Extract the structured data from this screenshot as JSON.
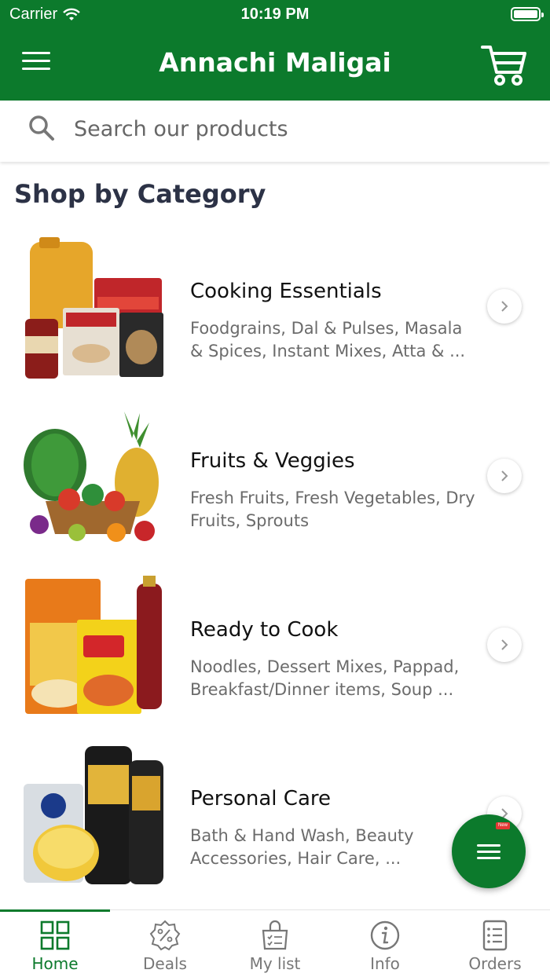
{
  "status_bar": {
    "carrier": "Carrier",
    "time": "10:19 PM"
  },
  "header": {
    "title": "Annachi Maligai",
    "menu_icon": "hamburger-menu-icon",
    "cart_icon": "shopping-cart-icon"
  },
  "search": {
    "placeholder": "Search our products",
    "icon": "search-icon"
  },
  "section_title": "Shop by Category",
  "categories": [
    {
      "name": "Cooking Essentials",
      "desc_line1": "Foodgrains, Dal & Pulses, Masala",
      "desc_line2": "& Spices, Instant Mixes, Atta & ..."
    },
    {
      "name": "Fruits & Veggies",
      "desc_line1": "Fresh Fruits, Fresh Vegetables, Dry",
      "desc_line2": "Fruits, Sprouts"
    },
    {
      "name": "Ready to Cook",
      "desc_line1": "Noodles, Dessert Mixes, Pappad,",
      "desc_line2": "Breakfast/Dinner items, Soup ..."
    },
    {
      "name": "Personal Care",
      "desc_line1": "Bath & Hand Wash, Beauty",
      "desc_line2": "Accessories, Hair Care, ..."
    }
  ],
  "fab": {
    "badge": "New"
  },
  "tabs": [
    {
      "label": "Home",
      "icon": "grid-home-icon",
      "active": true
    },
    {
      "label": "Deals",
      "icon": "deals-badge-icon",
      "active": false
    },
    {
      "label": "My list",
      "icon": "shopping-list-bag-icon",
      "active": false
    },
    {
      "label": "Info",
      "icon": "info-icon",
      "active": false
    },
    {
      "label": "Orders",
      "icon": "orders-receipt-icon",
      "active": false
    }
  ],
  "colors": {
    "brand_green": "#0c7a2c",
    "title_dark": "#2c3246"
  }
}
